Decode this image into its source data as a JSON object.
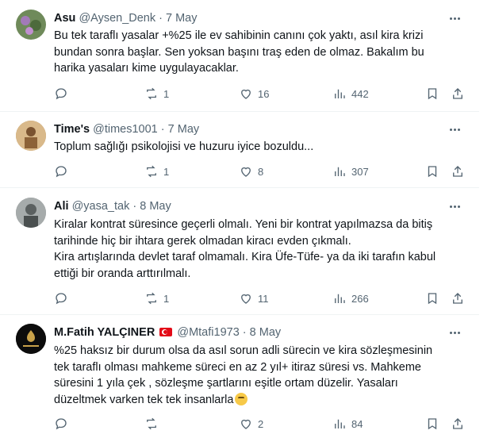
{
  "tweets": [
    {
      "name": "Asu",
      "handle": "@Aysen_Denk",
      "sep": "·",
      "date": "7 May",
      "lines": [
        "Bu tek taraflı yasalar +%25 ile ev sahibinin canını  çok yaktı, asıl kira krizi",
        "bundan sonra başlar. Sen yoksan başını traş eden de olmaz. Bakalım bu",
        "harika yasaları kime uygulayacaklar."
      ],
      "reply_count": "",
      "retweet_count": "1",
      "like_count": "16",
      "view_count": "442",
      "avatar_color": "#6f8a5a"
    },
    {
      "name": "Time's",
      "handle": "@times1001",
      "sep": "·",
      "date": "7 May",
      "lines": [
        "Toplum sağlığı psikolojisi ve huzuru iyice bozuldu..."
      ],
      "reply_count": "",
      "retweet_count": "1",
      "like_count": "8",
      "view_count": "307",
      "avatar_color": "#b58a55"
    },
    {
      "name": "Ali",
      "handle": "@yasa_tak",
      "sep": "·",
      "date": "8 May",
      "lines": [
        "Kiralar kontrat süresince geçerli olmalı. Yeni bir kontrat yapılmazsa da bitiş",
        "tarihinde hiç bir ihtara gerek olmadan kiracı evden çıkmalı.",
        "Kira artışlarında devlet taraf olmamalı. Kira Üfe-Tüfe- ya da iki tarafın kabul",
        "ettiği bir oranda arttırılmalı."
      ],
      "reply_count": "",
      "retweet_count": "1",
      "like_count": "11",
      "view_count": "266",
      "avatar_color": "#8a8f8f"
    },
    {
      "name": "M.Fatih YALÇINER",
      "handle": "@Mtafi1973",
      "sep": "·",
      "date": "8 May",
      "lines": [
        "%25 haksız bir durum olsa da asıl sorun adli sürecin ve kira sözleşmesinin",
        "tek taraflı olması mahkeme süreci en az 2 yıl+ itiraz süresi vs. Mahkeme",
        "süresini 1 yıla çek , sözleşme şartlarını eşitle ortam düzelir. Yasaları",
        "düzeltmek varken tek tek insanlarla"
      ],
      "reply_count": "",
      "retweet_count": "",
      "like_count": "2",
      "view_count": "84",
      "avatar_color": "#111111"
    }
  ],
  "icons": {
    "reply": "reply-icon",
    "retweet": "retweet-icon",
    "like": "heart-icon",
    "views": "views-icon",
    "bookmark": "bookmark-icon",
    "share": "share-icon",
    "more": "more-icon",
    "flag": "turkey-flag-icon",
    "emoji": "thinking-face-icon"
  }
}
